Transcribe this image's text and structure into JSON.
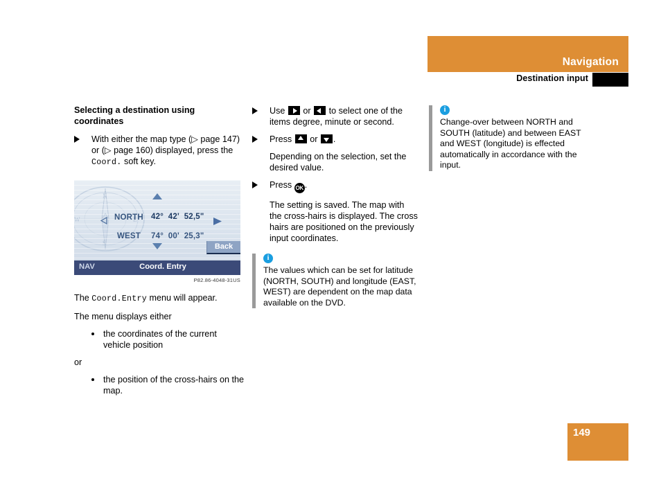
{
  "header": {
    "title": "Navigation",
    "subtitle": "Destination input",
    "accent_color": "#de8e35",
    "black_color": "#000000"
  },
  "footer": {
    "page_number": "149"
  },
  "left_column": {
    "section_title": "Selecting a destination using coordinates",
    "step1": {
      "text_a": "With either the map type (▷ page 147) or (▷ page 160) displayed, press the ",
      "mono": "Coord.",
      "text_b": " soft key."
    },
    "after_figure": {
      "line1_a": "The ",
      "line1_mono": "Coord.Entry",
      "line1_b": " menu will appear.",
      "line2": "The menu displays either",
      "bullets": [
        "the coordinates of the current vehicle position",
        "the position of the cross-hairs on the map."
      ],
      "or_label": "or"
    }
  },
  "figure": {
    "caption": "P82.86-4048-31US",
    "screen": {
      "latitude_label": "NORTH",
      "latitude_value": "42°  42'  52,5\"",
      "longitude_label": "WEST",
      "longitude_value": "74°  00'  25,3\"",
      "back_key": "Back",
      "statusbar_left": "NAV",
      "statusbar_center": "Coord. Entry"
    }
  },
  "middle_column": {
    "step1": {
      "text_a": "Use ",
      "icon_a": "arrow-right-key-icon",
      "text_b": " or ",
      "icon_b": "arrow-left-key-icon",
      "text_c": " to select one of the items degree, minute or second."
    },
    "step2": {
      "text_a": "Press ",
      "icon_a": "arrow-up-key-icon",
      "text_b": " or ",
      "icon_b": "arrow-down-key-icon",
      "text_c": "."
    },
    "para2": "Depending on the selection, set the desired value.",
    "step3": {
      "text_a": "Press ",
      "icon_a": "ok-key-icon",
      "icon_label": "OK",
      "text_b": "."
    },
    "para3": "The setting is saved. The map with the cross-hairs is displayed. The cross hairs are positioned on the previously input coordinates.",
    "note": {
      "icon": "info-icon",
      "icon_glyph": "i",
      "text": "The values which can be set for latitude (NORTH, SOUTH) and longitude (EAST, WEST) are dependent on the map data available on the DVD."
    }
  },
  "right_column": {
    "note": {
      "icon": "info-icon",
      "icon_glyph": "i",
      "text": "Change-over between NORTH and SOUTH (latitude) and between EAST and WEST (longitude) is effected automatically in accordance with the input."
    }
  }
}
